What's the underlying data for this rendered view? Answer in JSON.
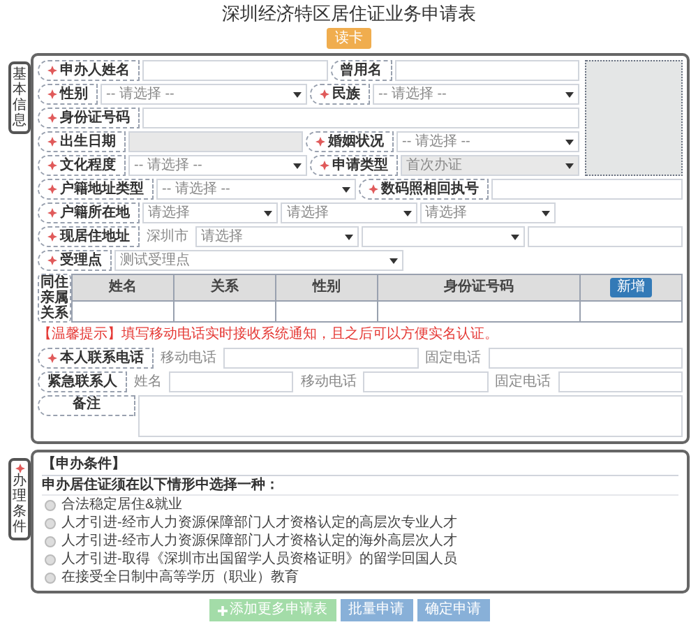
{
  "title": "深圳经济特区居住证业务申请表",
  "read_card_button": "读卡",
  "basic_info": {
    "tab_label": "基本信息",
    "rows_top": [
      {
        "controls": [
          {
            "kind": "label",
            "text": "申办人姓名",
            "required": true
          },
          {
            "kind": "input",
            "disabled": false
          },
          {
            "kind": "label",
            "text": "曾用名",
            "required": false
          },
          {
            "kind": "input",
            "disabled": false
          }
        ]
      },
      {
        "controls": [
          {
            "kind": "label",
            "text": "性别",
            "required": true
          },
          {
            "kind": "select",
            "value": "-- 请选择 --",
            "disabled": false
          },
          {
            "kind": "label",
            "text": "民族",
            "required": true
          },
          {
            "kind": "select",
            "value": "-- 请选择 --",
            "disabled": false
          }
        ]
      },
      {
        "controls": [
          {
            "kind": "label",
            "text": "身份证号码",
            "required": true
          },
          {
            "kind": "input",
            "disabled": false
          }
        ]
      },
      {
        "controls": [
          {
            "kind": "label",
            "text": "出生日期",
            "required": true
          },
          {
            "kind": "input",
            "disabled": true
          },
          {
            "kind": "label",
            "text": "婚姻状况",
            "required": true
          },
          {
            "kind": "select",
            "value": "-- 请选择 --",
            "disabled": false
          }
        ]
      },
      {
        "controls": [
          {
            "kind": "label",
            "text": "文化程度",
            "required": true
          },
          {
            "kind": "select",
            "value": "-- 请选择 --",
            "disabled": false
          },
          {
            "kind": "label",
            "text": "申请类型",
            "required": true
          },
          {
            "kind": "select",
            "value": "首次办证",
            "disabled": true
          }
        ]
      }
    ],
    "rows_middle": [
      {
        "controls": [
          {
            "kind": "label",
            "text": "户籍地址类型",
            "required": true
          },
          {
            "kind": "select",
            "value": "-- 请选择 --",
            "disabled": false
          },
          {
            "kind": "label",
            "text": "数码照相回执号",
            "required": true
          },
          {
            "kind": "input",
            "disabled": false
          }
        ]
      },
      {
        "controls": [
          {
            "kind": "label",
            "text": "户籍所在地",
            "required": true
          },
          {
            "kind": "select",
            "value": "请选择",
            "disabled": false
          },
          {
            "kind": "select",
            "value": "请选择",
            "disabled": false
          },
          {
            "kind": "select",
            "value": "请选择",
            "disabled": false
          },
          {
            "kind": "spacer"
          }
        ]
      },
      {
        "controls": [
          {
            "kind": "label",
            "text": "现居住地址",
            "required": true
          },
          {
            "kind": "text",
            "text": "深圳市"
          },
          {
            "kind": "select",
            "value": "请选择",
            "disabled": false
          },
          {
            "kind": "select",
            "disabled": false
          },
          {
            "kind": "input",
            "disabled": false
          }
        ]
      },
      {
        "controls": [
          {
            "kind": "label",
            "text": "受理点",
            "required": true
          },
          {
            "kind": "select",
            "value": "测试受理点",
            "disabled": false
          },
          {
            "kind": "spacer"
          }
        ]
      }
    ],
    "relatives": {
      "label": "同住亲属关系",
      "columns": [
        "姓名",
        "关系",
        "性别",
        "身份证号码"
      ],
      "add_button": "新增"
    },
    "hint": "【温馨提示】填写移动电话实时接收系统通知，且之后可以方便实名认证。",
    "rows_bottom": [
      {
        "controls": [
          {
            "kind": "label",
            "text": "本人联系电话",
            "required": true
          },
          {
            "kind": "text",
            "text": "移动电话"
          },
          {
            "kind": "input",
            "disabled": false
          },
          {
            "kind": "text",
            "text": "固定电话"
          },
          {
            "kind": "input",
            "disabled": false
          }
        ]
      },
      {
        "controls": [
          {
            "kind": "label",
            "text": "紧急联系人",
            "required": false
          },
          {
            "kind": "text",
            "text": "姓名"
          },
          {
            "kind": "input",
            "disabled": false
          },
          {
            "kind": "text",
            "text": "移动电话"
          },
          {
            "kind": "input",
            "disabled": false
          },
          {
            "kind": "text",
            "text": "固定电话"
          },
          {
            "kind": "input",
            "disabled": false
          }
        ]
      }
    ],
    "remark_label": "备注"
  },
  "conditions": {
    "tab_label": "办理条件",
    "required": true,
    "header": "【申办条件】",
    "question": "申办居住证须在以下情形中选择一种：",
    "options": [
      {
        "text": "合法稳定居住&就业",
        "selected": false
      },
      {
        "text": "人才引进-经市人力资源保障部门人才资格认定的高层次专业人才",
        "selected": false
      },
      {
        "text": "人才引进-经市人力资源保障部门人才资格认定的海外高层次人才",
        "selected": false
      },
      {
        "text": "人才引进-取得《深圳市出国留学人员资格证明》的留学回国人员",
        "selected": false
      },
      {
        "text": "在接受全日制中高等学历（职业）教育",
        "selected": false
      }
    ]
  },
  "buttons": [
    {
      "kind": "add",
      "text": "添加更多申请表"
    },
    {
      "kind": "primary",
      "text": "批量申请"
    },
    {
      "kind": "primary",
      "text": "确定申请"
    }
  ]
}
